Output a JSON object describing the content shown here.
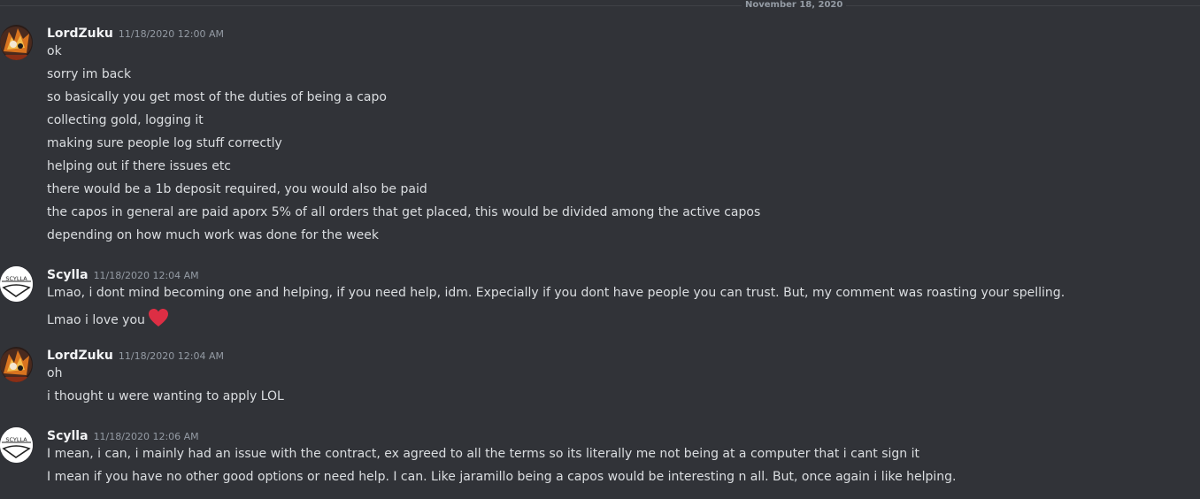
{
  "date_divider": "November 18, 2020",
  "groups": [
    {
      "username": "LordZuku",
      "timestamp": "11/18/2020 12:00 AM",
      "avatar": "fire-character-avatar",
      "lines": [
        "ok",
        "sorry im back",
        "so basically you get most of the duties of being a capo",
        "collecting gold, logging it",
        "making sure people log stuff correctly",
        "helping out if there issues etc",
        "there would be a 1b deposit required, you would also be paid",
        "the capos in general are paid aporx 5% of all orders that get placed, this would be divided among the active capos",
        "depending on how much work was done for the week"
      ]
    },
    {
      "username": "Scylla",
      "timestamp": "11/18/2020 12:04 AM",
      "avatar": "scylla-logo-avatar",
      "avatar_text": "SCYLLA",
      "lines": [
        "Lmao, i dont mind becoming one and helping, if you need help, idm. Expecially if you dont have people you can trust. But, my comment was roasting your spelling.",
        "Lmao i love you"
      ],
      "emoji": "red-heart-icon"
    },
    {
      "username": "LordZuku",
      "timestamp": "11/18/2020 12:04 AM",
      "avatar": "fire-character-avatar",
      "lines": [
        "oh",
        "i thought u were wanting to apply LOL"
      ]
    },
    {
      "username": "Scylla",
      "timestamp": "11/18/2020 12:06 AM",
      "avatar": "scylla-logo-avatar",
      "avatar_text": "SCYLLA",
      "lines": [
        "I mean, i can, i mainly had an issue with the contract, ex agreed to all the terms so its literally me not being at a computer that i cant sign it",
        "I mean if you have no other good options or need help. I can. Like jaramillo being a capos would be interesting n all.  But, once again i like helping."
      ]
    }
  ],
  "colors": {
    "background": "#313338",
    "username": "#f2f3f5",
    "message_text": "#dbdee1",
    "timestamp": "#949ba4",
    "heart": "#dd2e44"
  }
}
